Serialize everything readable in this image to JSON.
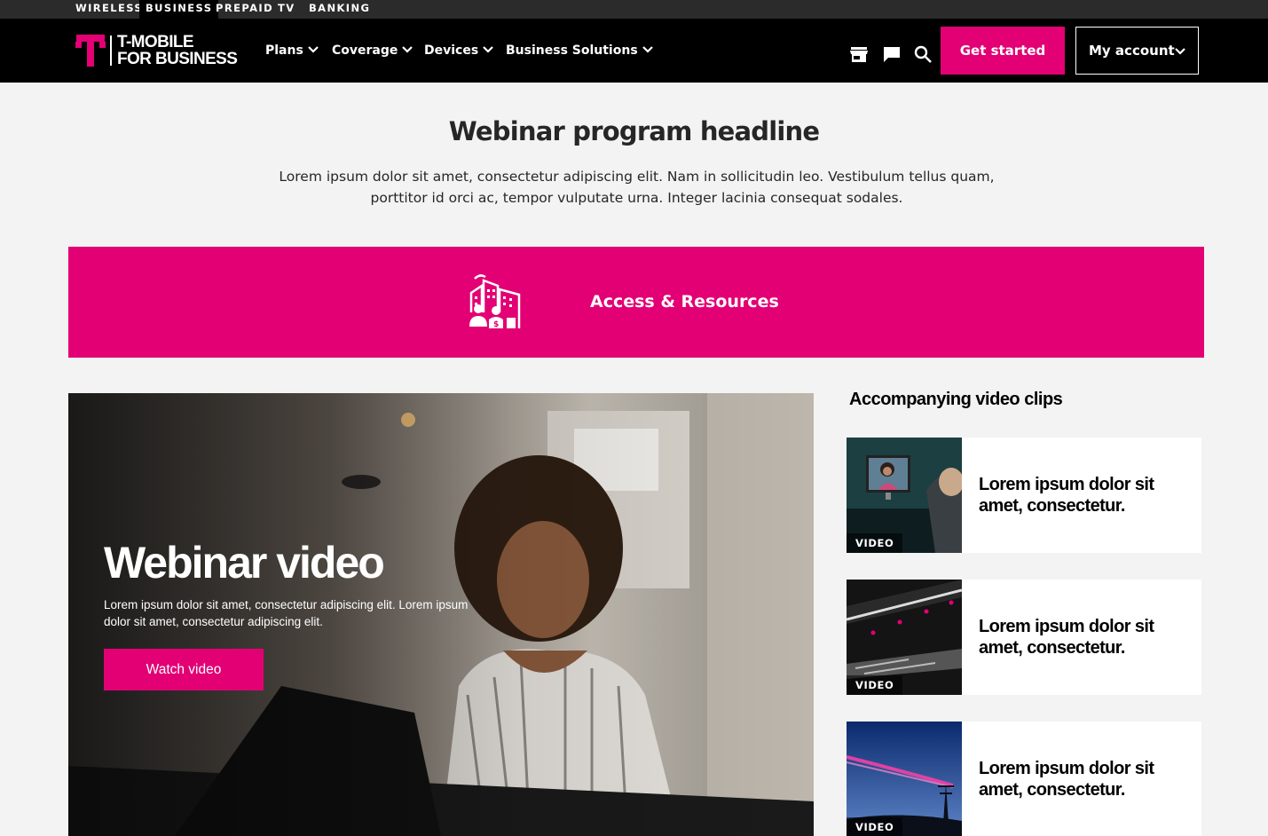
{
  "utility_nav": [
    "WIRELESS",
    "BUSINESS",
    "PREPAID",
    "TV",
    "BANKING"
  ],
  "utility_active": "BUSINESS",
  "brand": {
    "line1": "T-MOBILE",
    "line2": "FOR BUSINESS",
    "icon": "t-logo-icon"
  },
  "main_nav": [
    "Plans",
    "Coverage",
    "Devices",
    "Business Solutions"
  ],
  "header_icons": [
    "store-icon",
    "chat-icon",
    "search-icon"
  ],
  "buttons": {
    "get_started": "Get started",
    "my_account": "My account"
  },
  "intro": {
    "headline": "Webinar program headline",
    "text": "Lorem ipsum dolor sit amet, consectetur adipiscing elit. Nam in sollicitudin leo. Vestibulum tellus quam, porttitor id orci ac, tempor vulputate urna. Integer lacinia consequat sodales."
  },
  "banner": {
    "label": "Access & Resources",
    "icon": "business-people-buildings-icon"
  },
  "hero": {
    "title": "Webinar video",
    "description": "Lorem ipsum dolor sit amet, consectetur adipiscing elit. Lorem ipsum dolor sit amet, consectetur adipiscing elit.",
    "button": "Watch video"
  },
  "clips": {
    "title": "Accompanying video clips",
    "items": [
      {
        "tag": "VIDEO",
        "text": "Lorem ipsum dolor sit amet, consectetur."
      },
      {
        "tag": "VIDEO",
        "text": "Lorem ipsum dolor sit amet, consectetur."
      },
      {
        "tag": "VIDEO",
        "text": "Lorem ipsum dolor sit amet, consectetur."
      }
    ]
  },
  "colors": {
    "magenta": "#e20074",
    "black": "#000000",
    "background": "#f3f3f3"
  }
}
